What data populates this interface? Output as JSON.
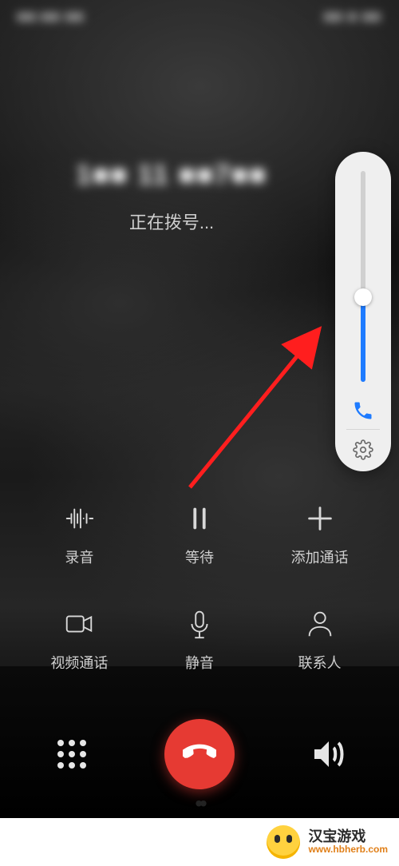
{
  "status": {
    "left": "■■:■■ ■■",
    "right": "■■ ■ ■■"
  },
  "caller": {
    "number_masked": "1■■ 11 ■■7■■",
    "state_text": "正在拨号..."
  },
  "volume": {
    "level_percent": 40,
    "icon": "phone-icon",
    "settings_icon": "gear-icon"
  },
  "actions": {
    "row1": [
      {
        "icon": "waveform-icon",
        "label": "录音"
      },
      {
        "icon": "pause-icon",
        "label": "等待"
      },
      {
        "icon": "plus-icon",
        "label": "添加通话"
      }
    ],
    "row2": [
      {
        "icon": "video-icon",
        "label": "视频通话"
      },
      {
        "icon": "mic-icon",
        "label": "静音"
      },
      {
        "icon": "person-icon",
        "label": "联系人"
      }
    ]
  },
  "bottom": {
    "dialpad_icon": "dialpad-icon",
    "hangup_icon": "phone-hangup-icon",
    "speaker_icon": "speaker-icon"
  },
  "watermark": {
    "title": "汉宝游戏",
    "url": "www.hbherb.com"
  },
  "colors": {
    "accent": "#1e7bff",
    "hangup": "#e63a33",
    "panel": "#efefef"
  }
}
